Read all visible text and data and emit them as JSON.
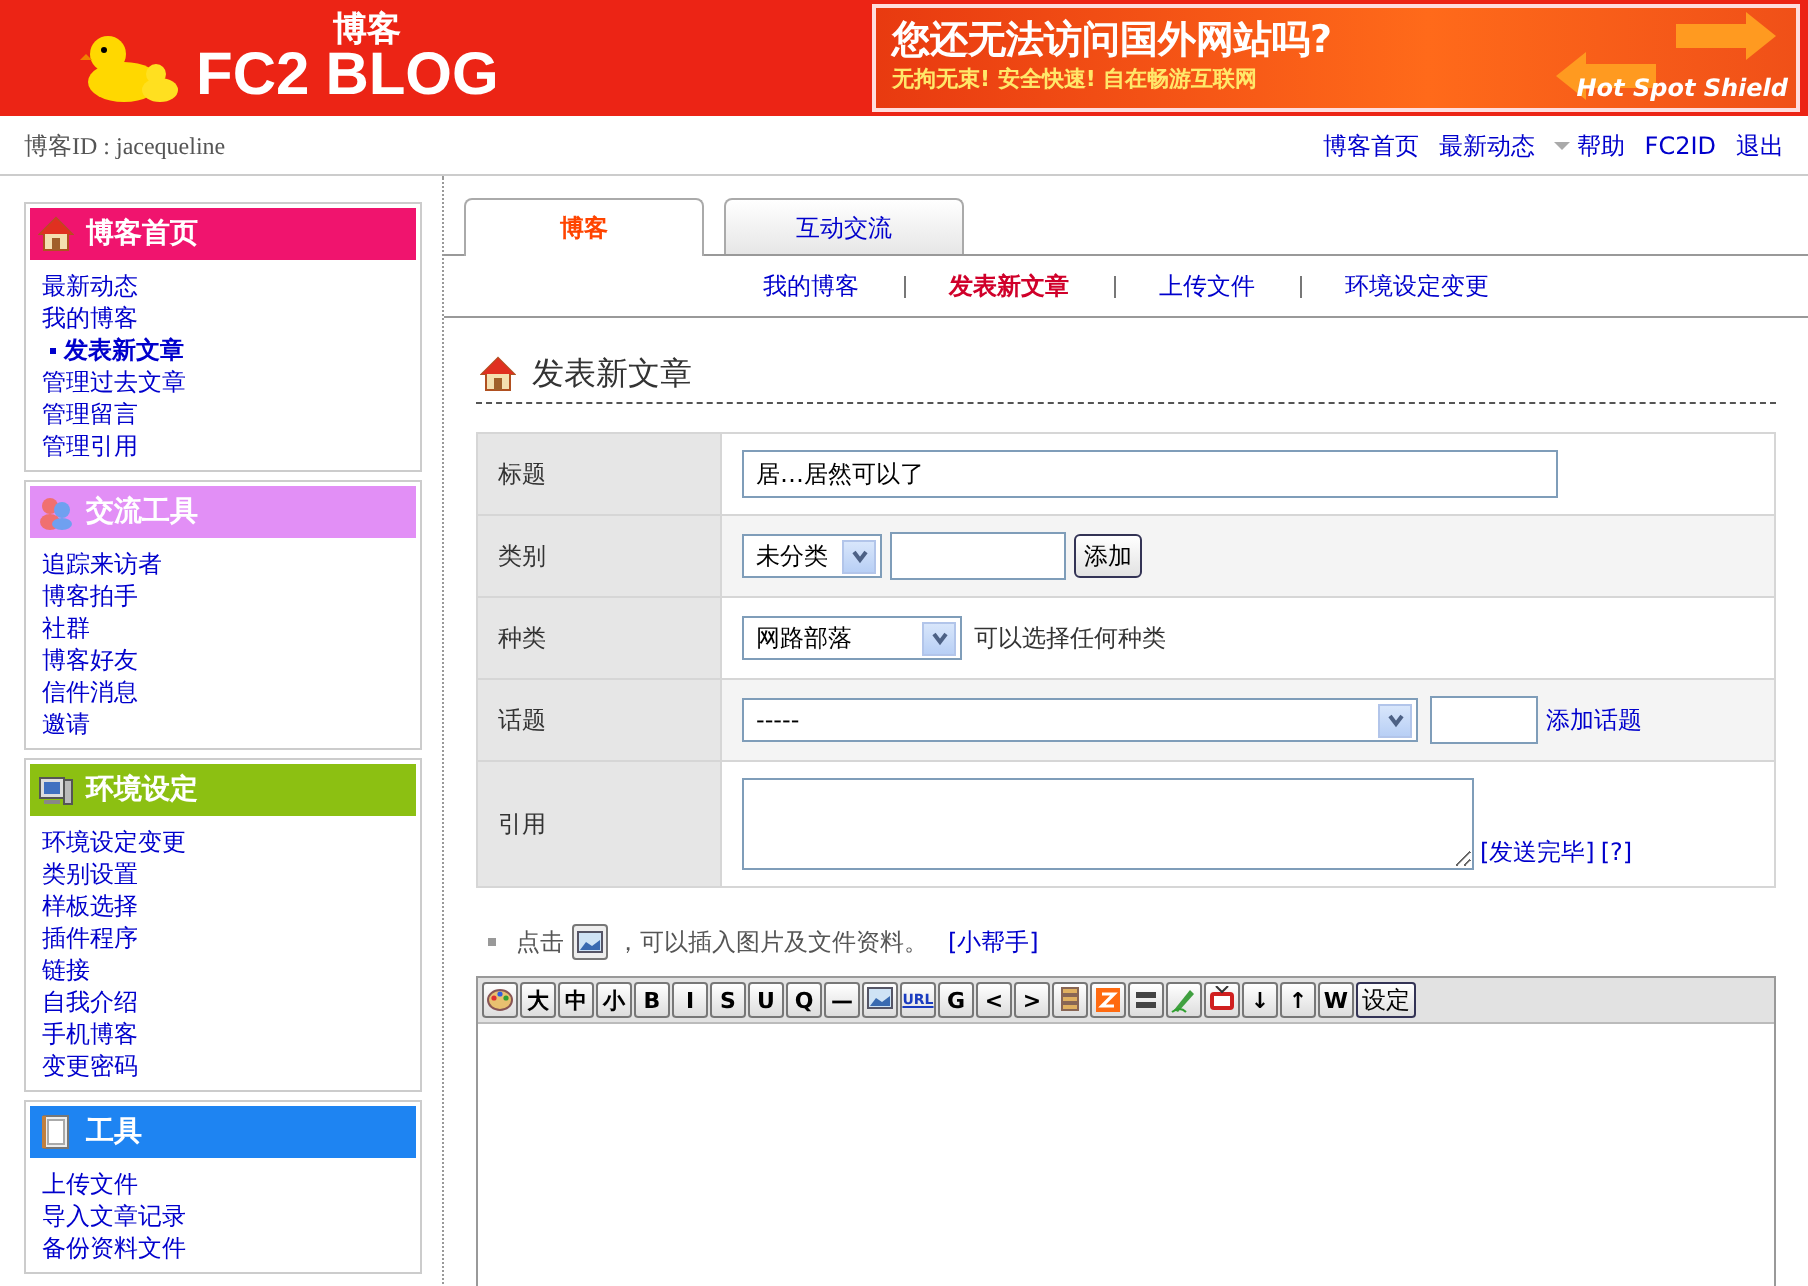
{
  "header": {
    "logo_main": "FC2",
    "logo_word": "BLOG",
    "logo_caption": "博客",
    "ad": {
      "headline": "您还无法访问国外网站吗?",
      "subline": "无拘无束! 安全快速! 自在畅游互联网",
      "brand": "Hot Spot Shield"
    }
  },
  "topbar": {
    "blog_id": "博客ID : jacequeline",
    "links": [
      {
        "label": "博客首页",
        "has_menu": false
      },
      {
        "label": "最新动态",
        "has_menu": false
      },
      {
        "label": "帮助",
        "has_menu": true
      },
      {
        "label": "FC2ID",
        "has_menu": false
      },
      {
        "label": "退出",
        "has_menu": false
      }
    ]
  },
  "sidebar": [
    {
      "title": "博客首页",
      "color": "#f0146e",
      "items": [
        {
          "label": "最新动态",
          "selected": false
        },
        {
          "label": "我的博客",
          "selected": false
        },
        {
          "label": "发表新文章",
          "selected": true
        },
        {
          "label": "管理过去文章",
          "selected": false
        },
        {
          "label": "管理留言",
          "selected": false
        },
        {
          "label": "管理引用",
          "selected": false
        }
      ]
    },
    {
      "title": "交流工具",
      "color": "#e28ff6",
      "items": [
        {
          "label": "追踪来访者",
          "selected": false
        },
        {
          "label": "博客拍手",
          "selected": false
        },
        {
          "label": "社群",
          "selected": false
        },
        {
          "label": "博客好友",
          "selected": false
        },
        {
          "label": "信件消息",
          "selected": false
        },
        {
          "label": "邀请",
          "selected": false
        }
      ]
    },
    {
      "title": "环境设定",
      "color": "#8cc012",
      "items": [
        {
          "label": "环境设定变更",
          "selected": false
        },
        {
          "label": "类别设置",
          "selected": false
        },
        {
          "label": "样板选择",
          "selected": false
        },
        {
          "label": "插件程序",
          "selected": false
        },
        {
          "label": "链接",
          "selected": false
        },
        {
          "label": "自我介绍",
          "selected": false
        },
        {
          "label": "手机博客",
          "selected": false
        },
        {
          "label": "变更密码",
          "selected": false
        }
      ]
    },
    {
      "title": "工具",
      "color": "#1e84f2",
      "items": [
        {
          "label": "上传文件",
          "selected": false
        },
        {
          "label": "导入文章记录",
          "selected": false
        },
        {
          "label": "备份资料文件",
          "selected": false
        }
      ]
    }
  ],
  "tabs": [
    {
      "label": "博客",
      "selected": true
    },
    {
      "label": "互动交流",
      "selected": false
    }
  ],
  "subnav": [
    {
      "label": "我的博客",
      "selected": false
    },
    {
      "label": "发表新文章",
      "selected": true
    },
    {
      "label": "上传文件",
      "selected": false
    },
    {
      "label": "环境设定变更",
      "selected": false
    }
  ],
  "page_title": "发表新文章",
  "form": [
    {
      "kind": "text",
      "label": "标题",
      "value": "居…居然可以了"
    },
    {
      "kind": "category",
      "label": "类别",
      "select": "未分类",
      "button": "添加"
    },
    {
      "kind": "genre",
      "label": "种类",
      "select": "网路部落",
      "hint": "可以选择任何种类"
    },
    {
      "kind": "topic",
      "label": "话题",
      "select": "-----",
      "link": "添加话题"
    },
    {
      "kind": "trackback",
      "label": "引用",
      "links": [
        "[发送完毕]",
        "[?]"
      ]
    }
  ],
  "hint": {
    "before": "点击",
    "after": "，可以插入图片及文件资料。",
    "link": "[小帮手]"
  },
  "toolbar": [
    {
      "kind": "icon"
    },
    {
      "kind": "text",
      "label": "大"
    },
    {
      "kind": "text",
      "label": "中"
    },
    {
      "kind": "text",
      "label": "小"
    },
    {
      "kind": "text",
      "label": "B"
    },
    {
      "kind": "text",
      "label": "I"
    },
    {
      "kind": "text",
      "label": "S"
    },
    {
      "kind": "text",
      "label": "U"
    },
    {
      "kind": "text",
      "label": "Q"
    },
    {
      "kind": "text",
      "label": "—"
    },
    {
      "kind": "icon"
    },
    {
      "kind": "text",
      "label": "URL"
    },
    {
      "kind": "text",
      "label": "G"
    },
    {
      "kind": "text",
      "label": "<"
    },
    {
      "kind": "text",
      "label": ">"
    },
    {
      "kind": "icon"
    },
    {
      "kind": "icon"
    },
    {
      "kind": "icon"
    },
    {
      "kind": "icon"
    },
    {
      "kind": "icon"
    },
    {
      "kind": "text",
      "label": "↓"
    },
    {
      "kind": "text",
      "label": "↑"
    },
    {
      "kind": "text",
      "label": "W"
    },
    {
      "kind": "wide",
      "label": "设定"
    }
  ]
}
